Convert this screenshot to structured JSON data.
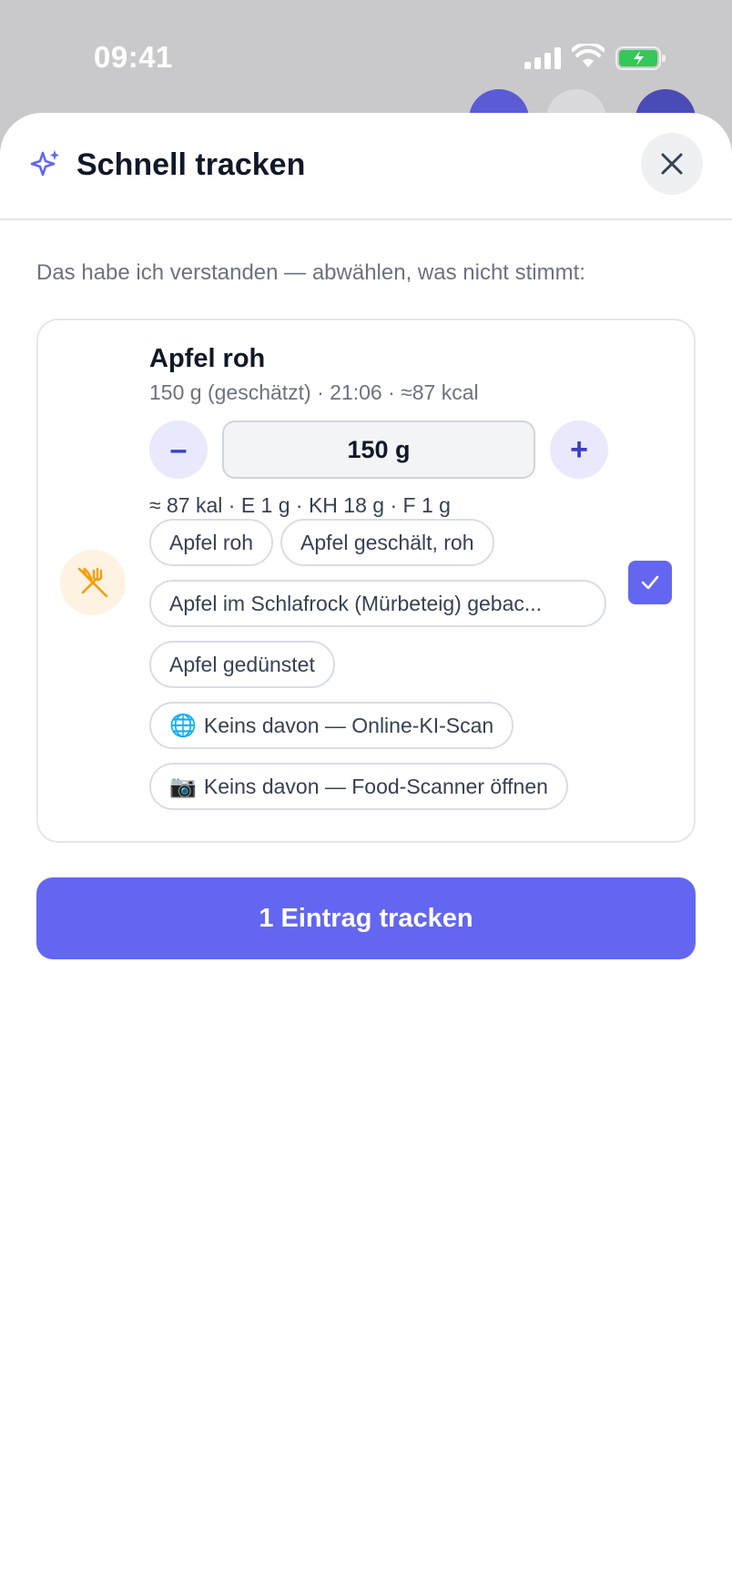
{
  "status_bar": {
    "time": "09:41"
  },
  "sheet": {
    "title": "Schnell tracken",
    "hint": "Das habe ich verstanden — abwählen, was nicht stimmt:"
  },
  "item": {
    "name": "Apfel roh",
    "meta": "150 g (geschätzt) · 21:06 · ≈87 kcal",
    "quantity": "150 g",
    "minus_label": "–",
    "plus_label": "+",
    "macros": "≈ 87 kal · E 1 g · KH 18 g · F 1 g",
    "selected": true,
    "alternatives": [
      {
        "label": "Apfel roh"
      },
      {
        "label": "Apfel geschält, roh"
      },
      {
        "label": "Apfel im Schlafrock (Mürbeteig) gebac..."
      },
      {
        "label": "Apfel gedünstet"
      },
      {
        "emoji": "🌐",
        "label": "Keins davon — Online-KI-Scan"
      },
      {
        "emoji": "📷",
        "label": "Keins davon — Food-Scanner öffnen"
      }
    ]
  },
  "cta": {
    "label": "1 Eintrag tracken"
  },
  "colors": {
    "accent": "#6366f1",
    "accent_soft": "#e8e9fb",
    "food_icon": "#f59e0b",
    "food_icon_bg": "#fef3e2"
  },
  "icons": {
    "header": "sparkle-icon",
    "close": "close-icon",
    "food": "fork-knife-crossed-icon",
    "check": "check-icon"
  }
}
